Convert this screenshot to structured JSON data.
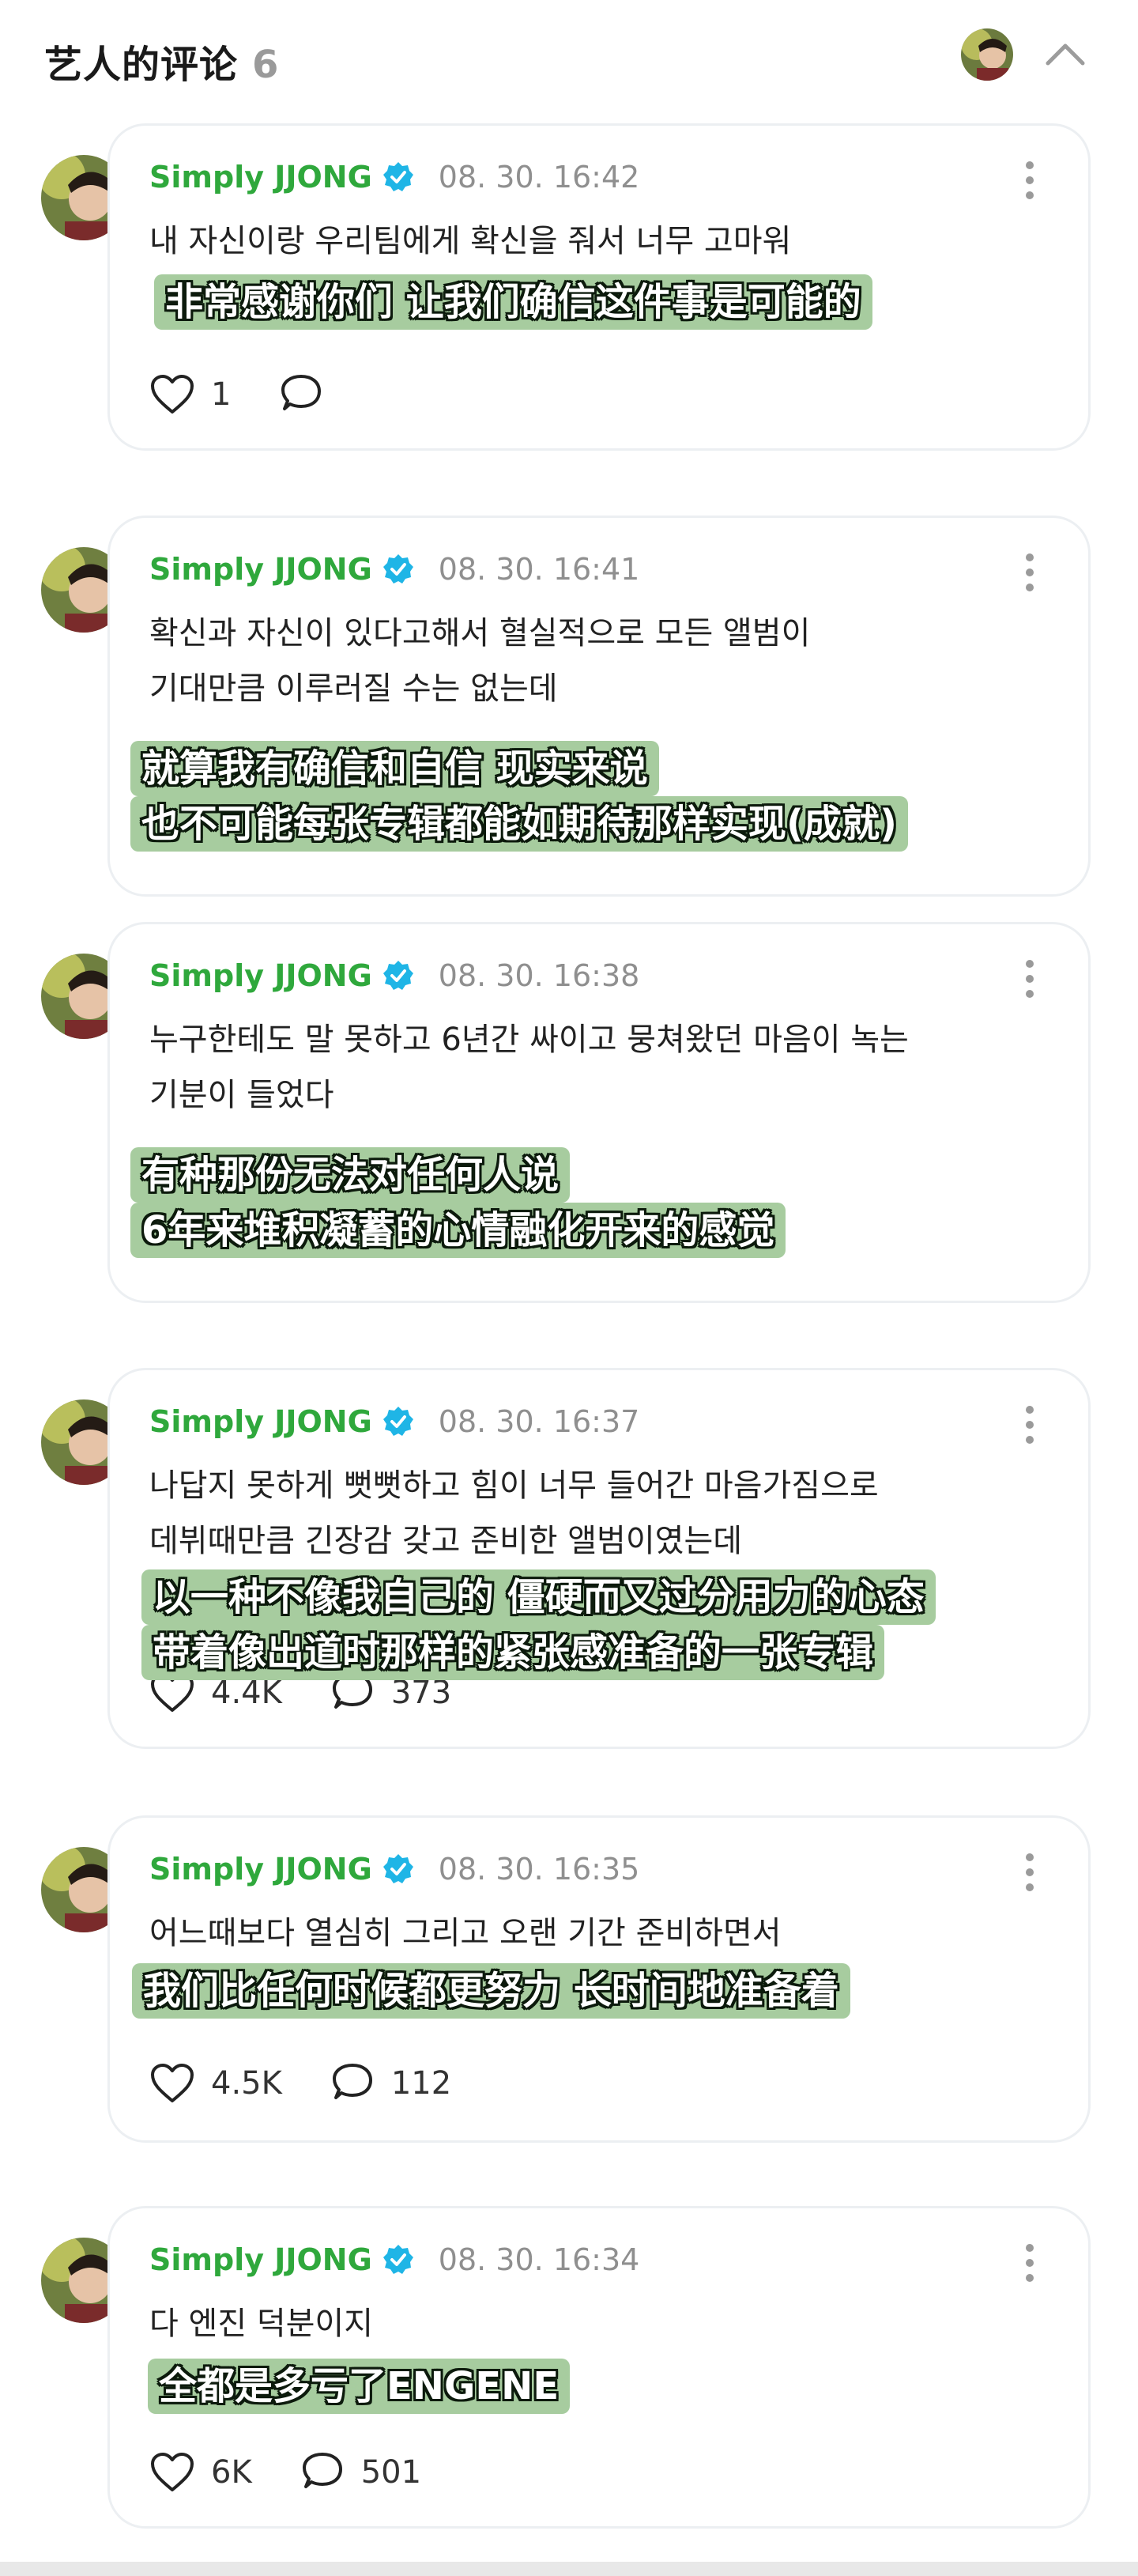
{
  "header": {
    "title": "艺人的评论",
    "count": "6"
  },
  "comments": [
    {
      "name": "Simply JJONG",
      "time": "08. 30. 16:42",
      "korean": [
        "내 자신이랑 우리팀에게 확신을 줘서 너무 고마워"
      ],
      "subtitle": [
        "非常感谢你们 让我们确信这件事是可能的"
      ],
      "likes": "1",
      "replies": ""
    },
    {
      "name": "Simply JJONG",
      "time": "08. 30. 16:41",
      "korean": [
        "확신과 자신이 있다고해서 혈실적으로 모든 앨범이",
        "기대만큼 이루러질 수는 없는데"
      ],
      "subtitle": [
        "就算我有确信和自信 现实来说",
        "也不可能每张专辑都能如期待那样实现(成就)"
      ],
      "likes": "",
      "replies": ""
    },
    {
      "name": "Simply JJONG",
      "time": "08. 30. 16:38",
      "korean": [
        "누구한테도 말 못하고 6년간 싸이고 뭉쳐왔던 마음이 녹는",
        "기분이 들었다"
      ],
      "subtitle": [
        "有种那份无法对任何人说",
        "6年来堆积凝蓄的心情融化开来的感觉"
      ],
      "likes": "",
      "replies": ""
    },
    {
      "name": "Simply JJONG",
      "time": "08. 30. 16:37",
      "korean": [
        "나답지 못하게 뻣뻣하고 힘이 너무 들어간 마음가짐으로",
        "데뷔때만큼 긴장감 갖고 준비한 앨범이였는데"
      ],
      "subtitle": [
        "以一种不像我自己的 僵硬而又过分用力的心态",
        "带着像出道时那样的紧张感准备的一张专辑"
      ],
      "likes": "4.4K",
      "replies": "373"
    },
    {
      "name": "Simply JJONG",
      "time": "08. 30. 16:35",
      "korean": [
        "어느때보다 열심히 그리고 오랜 기간 준비하면서"
      ],
      "subtitle": [
        "我们比任何时候都更努力 长时间地准备着"
      ],
      "likes": "4.5K",
      "replies": "112"
    },
    {
      "name": "Simply JJONG",
      "time": "08. 30. 16:34",
      "korean": [
        "다 엔진 덕분이지"
      ],
      "subtitle": [
        "全都是多亏了ENGENE"
      ],
      "likes": "6K",
      "replies": "501"
    }
  ],
  "colors": {
    "name": "#2fa83c",
    "verified": "#1fb5e6",
    "subtitle_bg": "#a7cc9f",
    "card_border": "#eceff2"
  },
  "icons": {
    "header_toggle": "chevron-up-icon",
    "menu": "more-vertical-icon",
    "like": "heart-icon",
    "reply": "speech-bubble-icon",
    "verified": "verified-badge-icon"
  }
}
